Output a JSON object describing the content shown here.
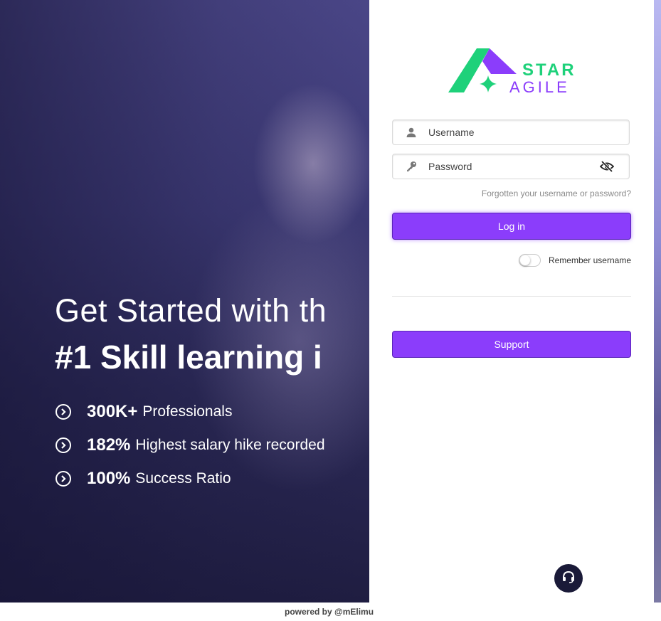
{
  "hero": {
    "line1": "Get Started with th",
    "line2": "#1 Skill learning i",
    "stats": [
      {
        "value": "300K+",
        "label": "Professionals"
      },
      {
        "value": "182%",
        "label": "Highest salary hike recorded"
      },
      {
        "value": "100%",
        "label": "Success Ratio"
      }
    ]
  },
  "logo": {
    "word1": "STAR",
    "word2": "AGILE",
    "colors": {
      "green": "#1ed17a",
      "purple": "#8b3dfb"
    }
  },
  "login": {
    "username_placeholder": "Username",
    "password_placeholder": "Password",
    "forgot_link": "Forgotten your username or password?",
    "login_button": "Log in",
    "remember_label": "Remember username",
    "remember_checked": false,
    "support_button": "Support"
  },
  "footer": {
    "text": "powered by @mElimu"
  },
  "colors": {
    "accent": "#8b3dfb",
    "help_fab": "#1a1a38"
  },
  "icons": [
    "user-icon",
    "key-icon",
    "eye-slash-icon",
    "chevron-right-circle-icon",
    "headset-icon"
  ]
}
